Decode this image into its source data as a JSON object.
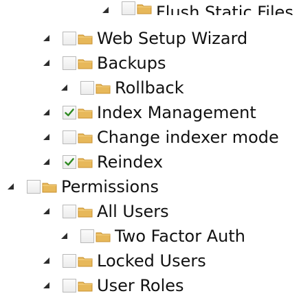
{
  "tree": {
    "items": [
      {
        "label": "Flush Static Files",
        "checked": false
      },
      {
        "label": "Web Setup Wizard",
        "checked": false
      },
      {
        "label": "Backups",
        "checked": false
      },
      {
        "label": "Rollback",
        "checked": false
      },
      {
        "label": "Index Management",
        "checked": true
      },
      {
        "label": "Change indexer mode",
        "checked": false
      },
      {
        "label": "Reindex",
        "checked": true
      },
      {
        "label": "Permissions",
        "checked": false
      },
      {
        "label": "All Users",
        "checked": false
      },
      {
        "label": "Two Factor Auth",
        "checked": false
      },
      {
        "label": "Locked Users",
        "checked": false
      },
      {
        "label": "User Roles",
        "checked": false
      }
    ]
  },
  "colors": {
    "checkmark": "#2f8a22",
    "folder": "#e7b85a",
    "folder_dark": "#c8912f",
    "text": "#111111"
  },
  "icons": {
    "expander": "triangle-expanded-icon",
    "folder": "folder-icon",
    "checkbox": "checkbox-icon",
    "checkmark": "checkmark-icon"
  }
}
